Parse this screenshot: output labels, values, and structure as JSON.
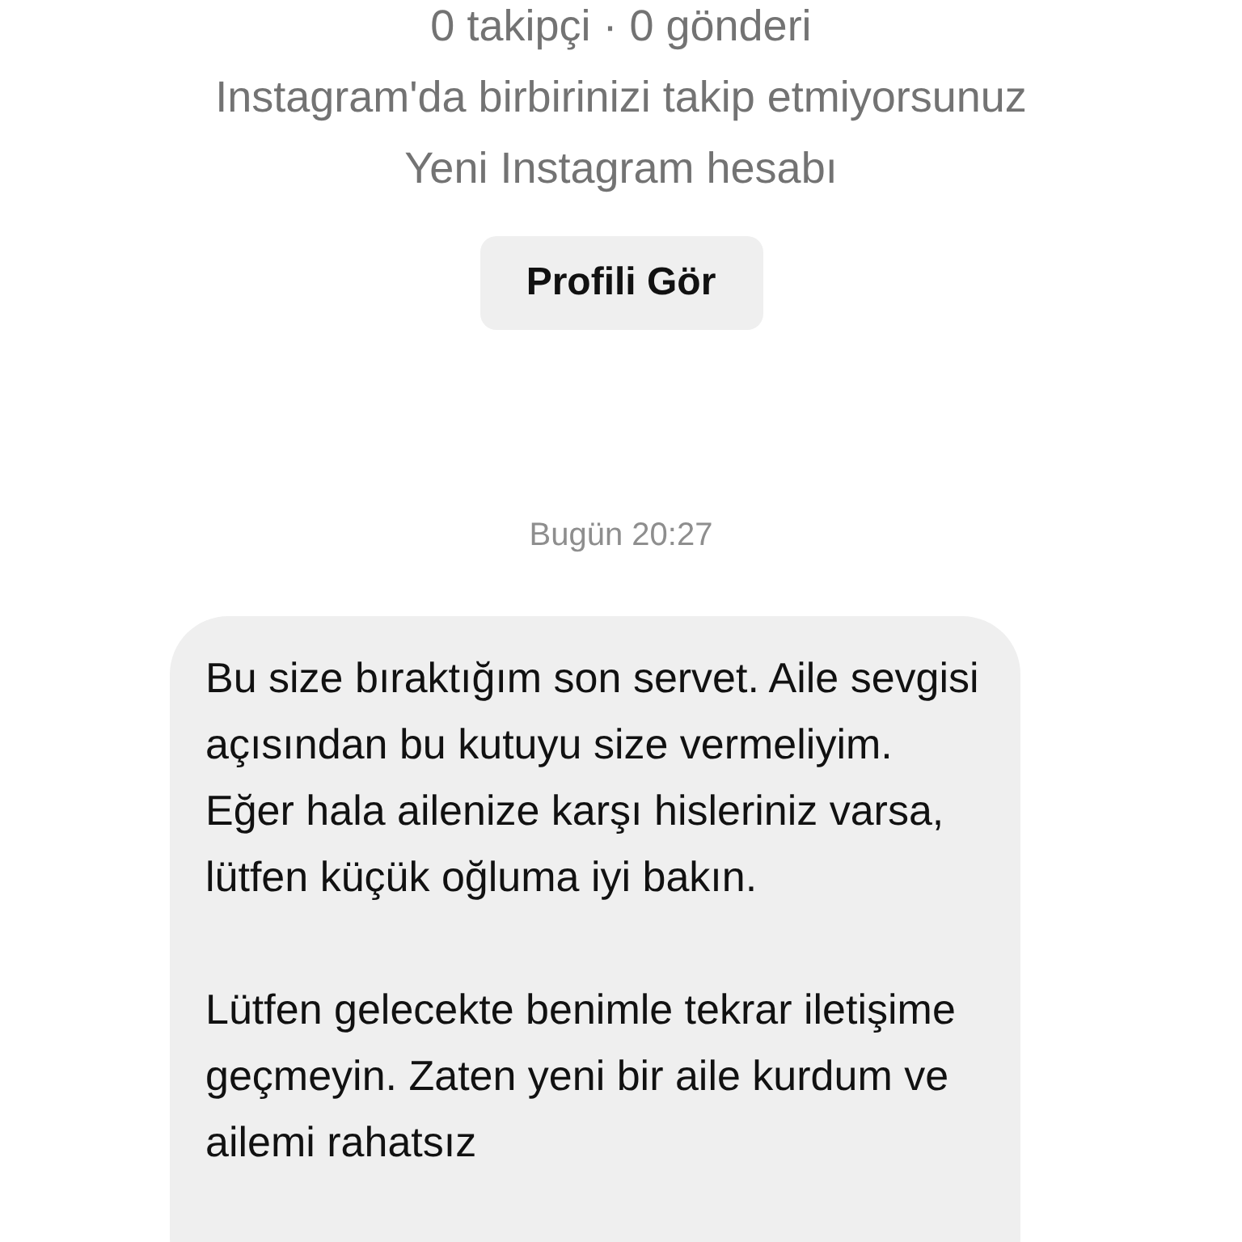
{
  "profile": {
    "stats": "0 takipçi · 0 gönderi",
    "relation": "Instagram'da birbirinizi takip etmiyorsunuz",
    "note": "Yeni Instagram hesabı",
    "button": "Profili Gör"
  },
  "timestamp": "Bugün 20:27",
  "message": {
    "paragraphs": [
      "Bu size bıraktığım son servet. Aile sevgisi açısından bu kutuyu size vermeliyim. Eğer hala ailenize karşı hisleriniz varsa, lütfen küçük oğluma iyi bakın.",
      "Lütfen gelecekte benimle tekrar iletişime geçmeyin. Zaten yeni bir aile kurdum ve ailemi rahatsız"
    ]
  }
}
